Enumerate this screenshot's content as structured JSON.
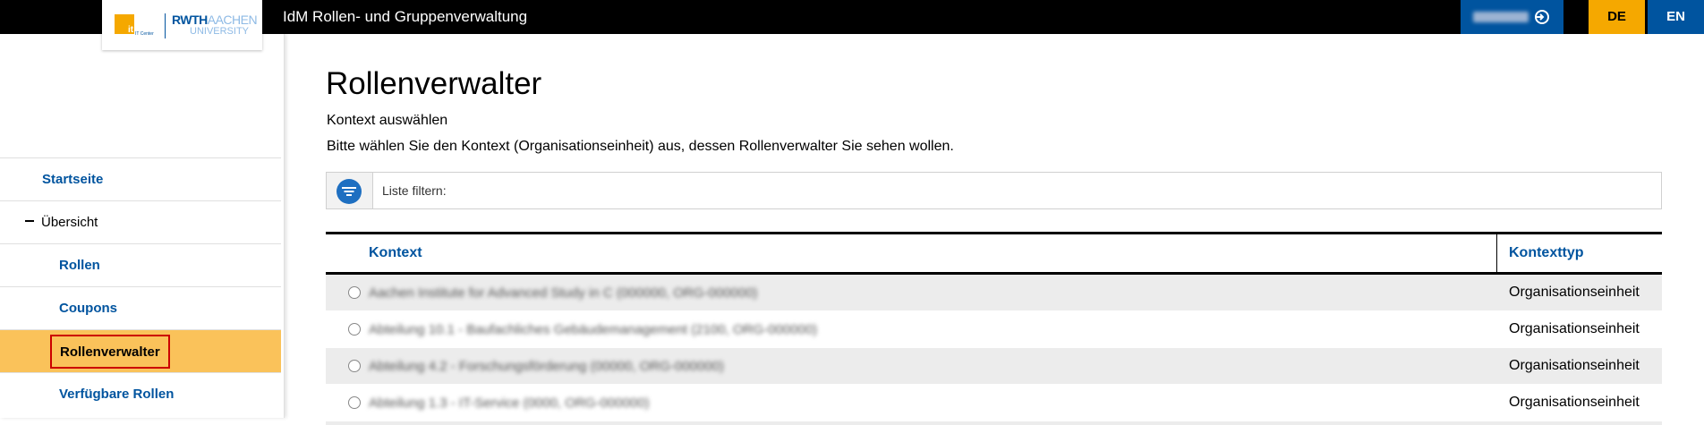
{
  "header": {
    "app_title": "IdM Rollen- und Gruppenverwaltung",
    "user_label": "xxxxxxxxxx",
    "lang_de": "DE",
    "lang_en": "EN"
  },
  "logo": {
    "it_letters": "it",
    "it_center": "IT Center",
    "rwth": "RWTH",
    "aachen": "AACHEN",
    "university": "UNIVERSITY"
  },
  "sidebar": {
    "items": [
      {
        "label": "Startseite"
      },
      {
        "label": "Übersicht"
      },
      {
        "label": "Rollen"
      },
      {
        "label": "Coupons"
      },
      {
        "label": "Rollenverwalter"
      },
      {
        "label": "Verfügbare Rollen"
      }
    ]
  },
  "main": {
    "title": "Rollenverwalter",
    "subtitle": "Kontext auswählen",
    "description": "Bitte wählen Sie den Kontext (Organisationseinheit) aus, dessen Rollenverwalter Sie sehen wollen.",
    "filter_label": "Liste filtern:",
    "table": {
      "columns": [
        "Kontext",
        "Kontexttyp"
      ],
      "rows": [
        {
          "kontext": "Aachen Institute for Advanced Study in C (000000, ORG-000000)",
          "typ": "Organisationseinheit"
        },
        {
          "kontext": "Abteilung 10.1 - Baufachliches Gebäudemanagement (2100, ORG-000000)",
          "typ": "Organisationseinheit"
        },
        {
          "kontext": "Abteilung 4.2 - Forschungsförderung (00000, ORG-000000)",
          "typ": "Organisationseinheit"
        },
        {
          "kontext": "Abteilung 1.3 - IT-Service (0000, ORG-000000)",
          "typ": "Organisationseinheit"
        }
      ]
    }
  },
  "colors": {
    "brand_blue": "#00549f",
    "brand_yellow": "#f5a800",
    "active_nav": "#fac25a",
    "active_outline": "#cc0000"
  }
}
